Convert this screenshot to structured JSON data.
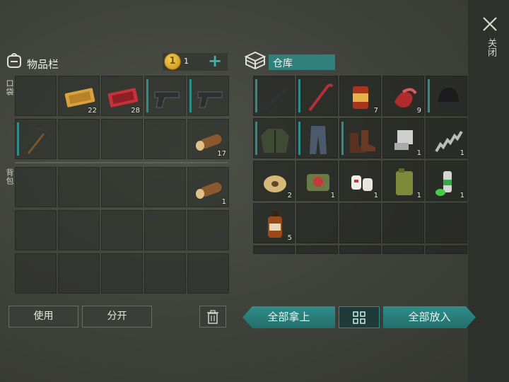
{
  "close": {
    "label": "关闭"
  },
  "inventory": {
    "title": "物品栏",
    "coins": "1",
    "add": "+",
    "pocket_label": "口袋",
    "backpack_label": "背包",
    "slots": [
      {
        "icon": "empty",
        "qty": ""
      },
      {
        "icon": "gold-coupon-icon",
        "qty": "22"
      },
      {
        "icon": "red-coupon-icon",
        "qty": "28"
      },
      {
        "icon": "pistol-icon",
        "qty": ""
      },
      {
        "icon": "pistol-icon",
        "qty": ""
      },
      {
        "icon": "pickaxe-icon",
        "qty": ""
      },
      {
        "icon": "empty",
        "qty": ""
      },
      {
        "icon": "empty",
        "qty": ""
      },
      {
        "icon": "empty",
        "qty": ""
      },
      {
        "icon": "log-icon",
        "qty": "17"
      }
    ],
    "backpack_slots": [
      {
        "icon": "empty",
        "qty": ""
      },
      {
        "icon": "empty",
        "qty": ""
      },
      {
        "icon": "empty",
        "qty": ""
      },
      {
        "icon": "empty",
        "qty": ""
      },
      {
        "icon": "log-icon",
        "qty": "1"
      }
    ]
  },
  "storage": {
    "title": "仓库",
    "slots": [
      {
        "icon": "rifle-icon",
        "qty": ""
      },
      {
        "icon": "crowbar-icon",
        "qty": ""
      },
      {
        "icon": "can-icon",
        "qty": "7"
      },
      {
        "icon": "meat-icon",
        "qty": "9"
      },
      {
        "icon": "beanie-icon",
        "qty": ""
      },
      {
        "icon": "jacket-icon",
        "qty": ""
      },
      {
        "icon": "pants-icon",
        "qty": ""
      },
      {
        "icon": "boots-icon",
        "qty": ""
      },
      {
        "icon": "engine-part-icon",
        "qty": "1"
      },
      {
        "icon": "spring-icon",
        "qty": "1"
      },
      {
        "icon": "wire-spool-icon",
        "qty": "2"
      },
      {
        "icon": "medkit-bag-icon",
        "qty": "1"
      },
      {
        "icon": "bandage-icon",
        "qty": "1"
      },
      {
        "icon": "jerrycan-icon",
        "qty": "1"
      },
      {
        "icon": "spray-can-icon",
        "qty": "1"
      },
      {
        "icon": "bottle-icon",
        "qty": "5"
      }
    ]
  },
  "buttons": {
    "use": "使用",
    "split": "分开",
    "take_all": "全部拿上",
    "put_all": "全部放入"
  },
  "colors": {
    "accent": "#2e8c8a"
  }
}
